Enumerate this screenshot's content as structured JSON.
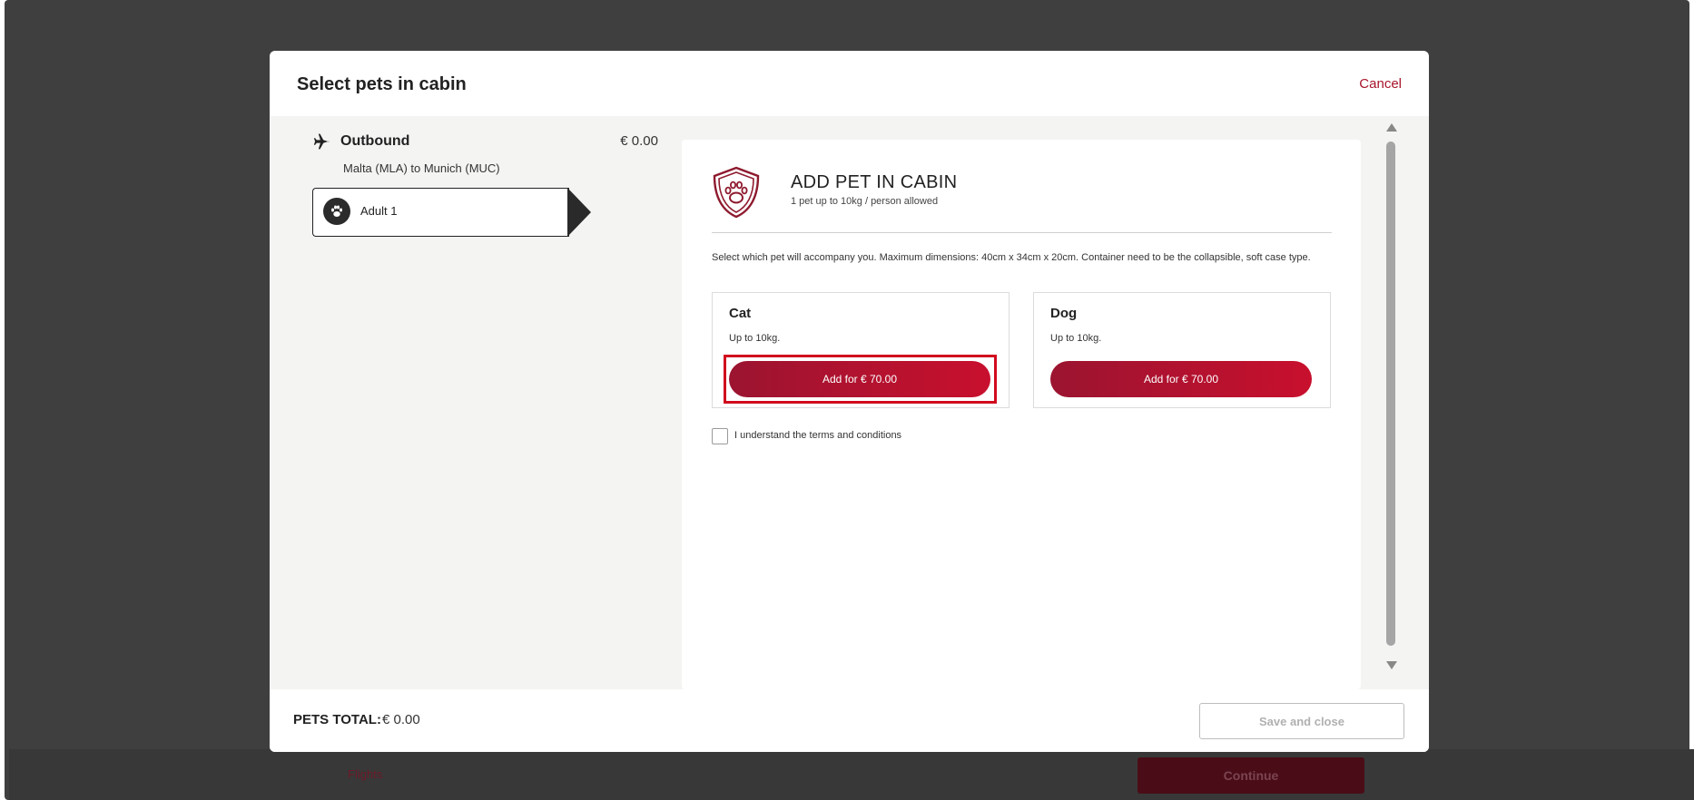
{
  "background": {
    "flights_link": "Flights",
    "continue_label": "Continue"
  },
  "modal": {
    "title": "Select pets in cabin",
    "cancel_label": "Cancel"
  },
  "flight": {
    "direction": "Outbound",
    "price": "€ 0.00",
    "route": "Malta (MLA) to Munich (MUC)",
    "passenger": "Adult 1"
  },
  "panel": {
    "title": "ADD PET IN CABIN",
    "subtitle": "1 pet up to 10kg / person allowed",
    "instructions": "Select which pet will accompany you. Maximum dimensions: 40cm x 34cm x 20cm. Container need to be the collapsible, soft case type.",
    "pets": [
      {
        "name": "Cat",
        "description": "Up to 10kg.",
        "button_label": "Add for € 70.00"
      },
      {
        "name": "Dog",
        "description": "Up to 10kg.",
        "button_label": "Add for € 70.00"
      }
    ],
    "terms_label": "I understand the terms and conditions",
    "terms_checked": false
  },
  "footer": {
    "total_label": "PETS TOTAL:",
    "total_value": "€ 0.00",
    "save_label": "Save and close"
  },
  "colors": {
    "brand_red": "#c8102e",
    "highlight": "#d10a1e"
  },
  "icons": {
    "plane": "plane-icon",
    "paw": "paw-icon",
    "shield": "pet-shield-icon"
  }
}
